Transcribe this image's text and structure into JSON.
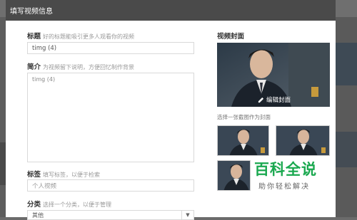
{
  "modal": {
    "title": "填写视频信息",
    "title_field": {
      "label": "标题",
      "hint": "好的标题能吸引更多人观看你的视频",
      "value": "timg (4)"
    },
    "intro_field": {
      "label": "简介",
      "hint": "为视频留下说明，方便回忆制作背景",
      "value": "timg (4)"
    },
    "tags_field": {
      "label": "标签",
      "hint": "填写标签，以便于检索",
      "placeholder": "个人视频"
    },
    "category_field": {
      "label": "分类",
      "hint": "选择一个分类，以便于管理",
      "selected": "其他"
    }
  },
  "cover": {
    "title": "视频封面",
    "edit_label": "编辑封面",
    "thumbs_hint": "选择一张截图作为封面"
  },
  "watermark": {
    "big": "百科全说",
    "small": "助你轻松解决"
  }
}
